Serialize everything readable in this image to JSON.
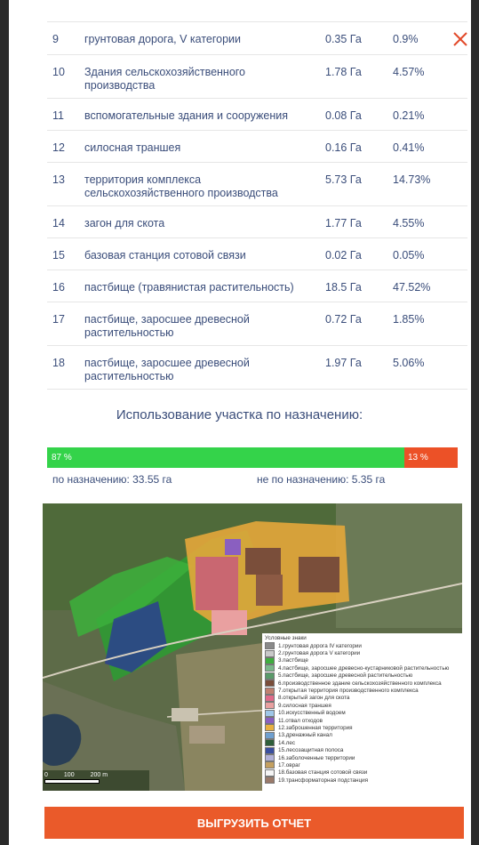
{
  "table": {
    "rows": [
      {
        "num": "9",
        "name": "грунтовая дорога, V категории",
        "area": "0.35 Га",
        "pct": "0.9%"
      },
      {
        "num": "10",
        "name": "Здания сельскохозяйственного производства",
        "area": "1.78 Га",
        "pct": "4.57%"
      },
      {
        "num": "11",
        "name": "вспомогательные здания и сооружения",
        "area": "0.08 Га",
        "pct": "0.21%"
      },
      {
        "num": "12",
        "name": "силосная траншея",
        "area": "0.16 Га",
        "pct": "0.41%"
      },
      {
        "num": "13",
        "name": "территория комплекса сельскохозяйственного производства",
        "area": "5.73 Га",
        "pct": "14.73%"
      },
      {
        "num": "14",
        "name": "загон для скота",
        "area": "1.77 Га",
        "pct": "4.55%"
      },
      {
        "num": "15",
        "name": "базовая станция сотовой связи",
        "area": "0.02 Га",
        "pct": "0.05%"
      },
      {
        "num": "16",
        "name": "пастбище (травянистая растительность)",
        "area": "18.5 Га",
        "pct": "47.52%"
      },
      {
        "num": "17",
        "name": "пастбище, заросшее древесной растительностью",
        "area": "0.72 Га",
        "pct": "1.85%"
      },
      {
        "num": "18",
        "name": "пастбище, заросшее древесной растительностью",
        "area": "1.97 Га",
        "pct": "5.06%"
      }
    ]
  },
  "usage": {
    "title": "Использование участка по назначению:",
    "in_purpose_label": "87 %",
    "in_purpose_fraction": 0.87,
    "not_purpose_label": "13 %",
    "in_purpose_caption": "по назначению: 33.55 га",
    "not_purpose_caption": "не по назначению: 5.35 га",
    "colors": {
      "green": "#34d34a",
      "red": "#ec5127"
    }
  },
  "map": {
    "legend_title": "Условные знаки",
    "legend": [
      {
        "label": "1.грунтовая дорога IV категории",
        "color": "#8a8a8a"
      },
      {
        "label": "2.грунтовая дорога V категории",
        "color": "#c9c9c9"
      },
      {
        "label": "3.пастбище",
        "color": "#3fae3f"
      },
      {
        "label": "4.пастбище, заросшее древесно-кустарниковой растительностью",
        "color": "#7ab88a"
      },
      {
        "label": "5.пастбище, заросшее древесной растительностью",
        "color": "#5a9a6a"
      },
      {
        "label": "6.производственное здание сельскохозяйственного комплекса",
        "color": "#7a4e3a"
      },
      {
        "label": "7.открытая территория производственного комплекса",
        "color": "#c08070"
      },
      {
        "label": "8.открытый загон для скота",
        "color": "#e06a8a"
      },
      {
        "label": "9.силосная траншея",
        "color": "#e9a0a0"
      },
      {
        "label": "10.искусственный водоем",
        "color": "#9fc7e8"
      },
      {
        "label": "11.отвал отходов",
        "color": "#8a5fc0"
      },
      {
        "label": "12.заброшенная территория",
        "color": "#e8b040"
      },
      {
        "label": "13.дренажный канал",
        "color": "#6fa0d0"
      },
      {
        "label": "14.лес",
        "color": "#2f5f3a"
      },
      {
        "label": "15.лесозащитная полоса",
        "color": "#3a4fa0"
      },
      {
        "label": "16.заболоченные территории",
        "color": "#b0b0d8"
      },
      {
        "label": "17.овраг",
        "color": "#c4a060"
      },
      {
        "label": "18.базовая станция сотовой связи",
        "color": "#f4f4f4"
      },
      {
        "label": "19.трансформаторная подстанция",
        "color": "#9a7a6a"
      }
    ],
    "scale_labels": [
      "0",
      "100",
      "200 m"
    ]
  },
  "export_button": "ВЫГРУЗИТЬ ОТЧЕТ"
}
